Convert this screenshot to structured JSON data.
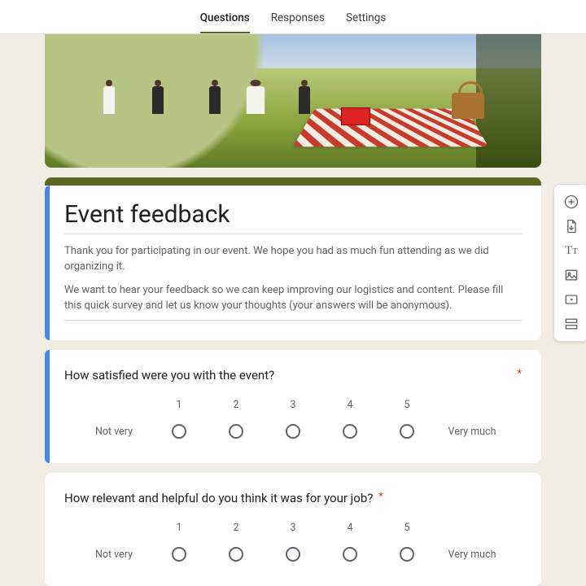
{
  "tabs": {
    "questions": "Questions",
    "responses": "Responses",
    "settings": "Settings",
    "active": "questions"
  },
  "header": {
    "title": "Event feedback",
    "description_p1": "Thank you for participating in our event. We hope you had as much fun attending as we did organizing it.",
    "description_p2": "We want to hear your feedback so we can keep improving our logistics and content. Please fill this quick survey and let us know your thoughts (your answers will be anonymous)."
  },
  "required_marker": "*",
  "scale": {
    "values": {
      "v1": "1",
      "v2": "2",
      "v3": "3",
      "v4": "4",
      "v5": "5"
    },
    "low_label": "Not very",
    "high_label": "Very much"
  },
  "questions": {
    "q1": {
      "text": "How satisfied were you with the event?",
      "required": true
    },
    "q2": {
      "text": "How relevant and helpful do you think it was for your job?",
      "required": true
    }
  },
  "toolbar": {
    "add_question": "add-question",
    "import_questions": "import-questions",
    "add_title": "add-title-description",
    "add_image": "add-image",
    "add_video": "add-video",
    "add_section": "add-section"
  },
  "theme": {
    "accent": "#5a6823",
    "focus": "#4285f4"
  }
}
